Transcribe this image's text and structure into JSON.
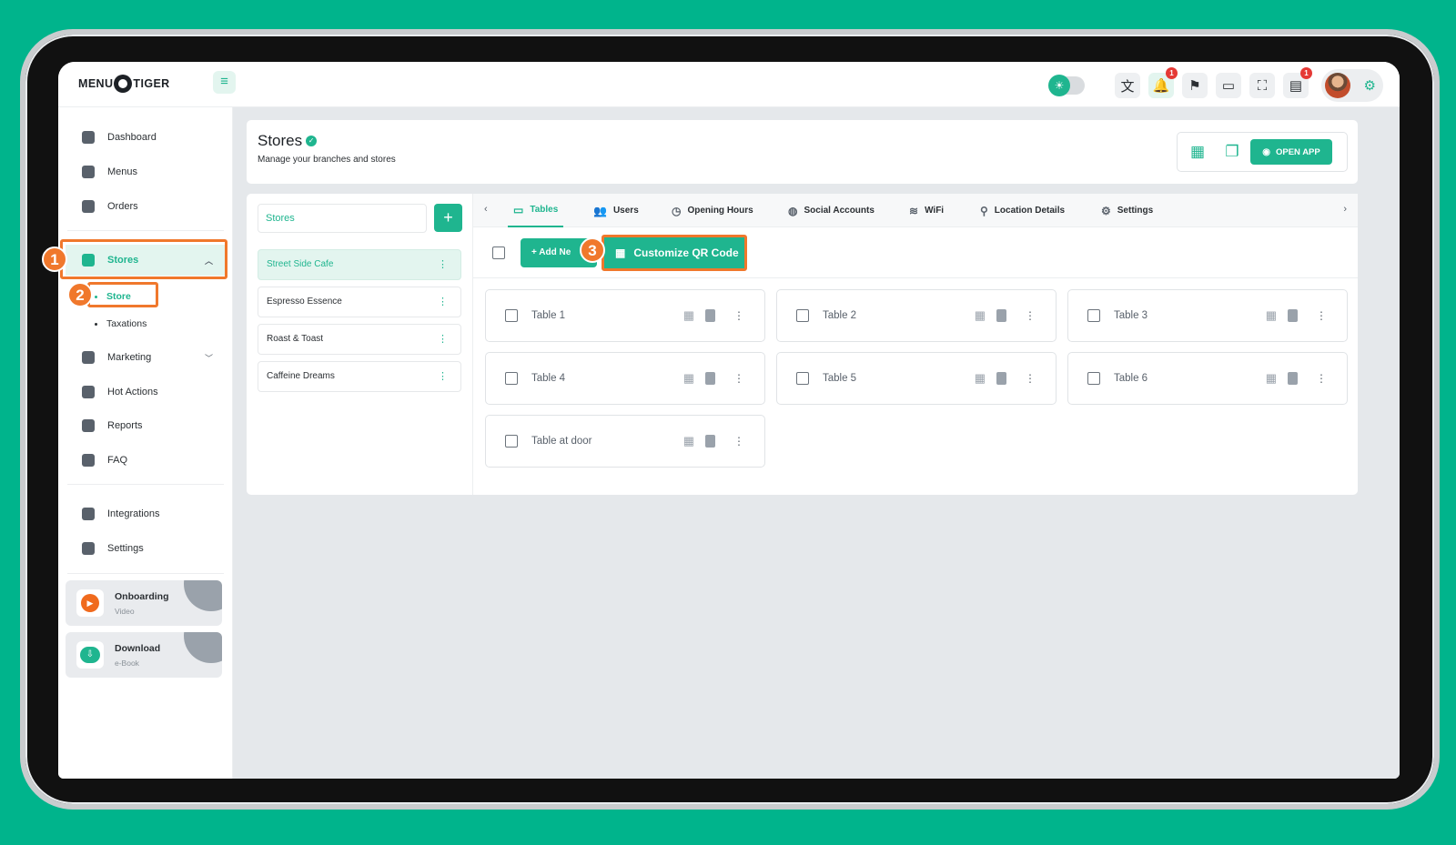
{
  "app": {
    "logo_left": "MENU",
    "logo_right": "TIGER",
    "notif_badge": "1",
    "docs_badge": "1"
  },
  "sidebar": {
    "items": [
      {
        "label": "Dashboard",
        "icon": "dashboard-icon"
      },
      {
        "label": "Menus",
        "icon": "menus-icon"
      },
      {
        "label": "Orders",
        "icon": "orders-icon"
      },
      {
        "label": "Stores",
        "icon": "stores-icon"
      },
      {
        "label": "Marketing",
        "icon": "marketing-icon"
      },
      {
        "label": "Hot Actions",
        "icon": "fire-icon"
      },
      {
        "label": "Reports",
        "icon": "reports-icon"
      },
      {
        "label": "FAQ",
        "icon": "faq-icon"
      },
      {
        "label": "Integrations",
        "icon": "puzzle-icon"
      },
      {
        "label": "Settings",
        "icon": "gear-icon"
      }
    ],
    "sub_items": [
      {
        "label": "Store"
      },
      {
        "label": "Taxations"
      }
    ],
    "promos": [
      {
        "title": "Onboarding",
        "subtitle": "Video"
      },
      {
        "title": "Download",
        "subtitle": "e-Book"
      }
    ]
  },
  "page": {
    "title": "Stores",
    "subtitle": "Manage your branches and stores",
    "open_app_label": "OPEN APP"
  },
  "stores": {
    "search_placeholder": "Stores",
    "items": [
      "Street Side Cafe",
      "Espresso Essence",
      "Roast & Toast",
      "Caffeine Dreams"
    ],
    "selected": "Street Side Cafe"
  },
  "tabs": [
    {
      "label": "Tables",
      "icon": "table-icon"
    },
    {
      "label": "Users",
      "icon": "users-icon"
    },
    {
      "label": "Opening Hours",
      "icon": "clock-icon"
    },
    {
      "label": "Social Accounts",
      "icon": "globe-icon"
    },
    {
      "label": "WiFi",
      "icon": "wifi-icon"
    },
    {
      "label": "Location Details",
      "icon": "pin-icon"
    },
    {
      "label": "Settings",
      "icon": "gear-icon"
    }
  ],
  "toolbar": {
    "add_new_label": "Add Ne",
    "customize_label": "Customize QR Code"
  },
  "tables": [
    "Table 1",
    "Table 2",
    "Table 3",
    "Table 4",
    "Table 5",
    "Table 6",
    "Table at door"
  ],
  "callouts": [
    "1",
    "2",
    "3"
  ],
  "colors": {
    "accent": "#1fb58f",
    "callout": "#f0782c",
    "background": "#00b48c"
  }
}
